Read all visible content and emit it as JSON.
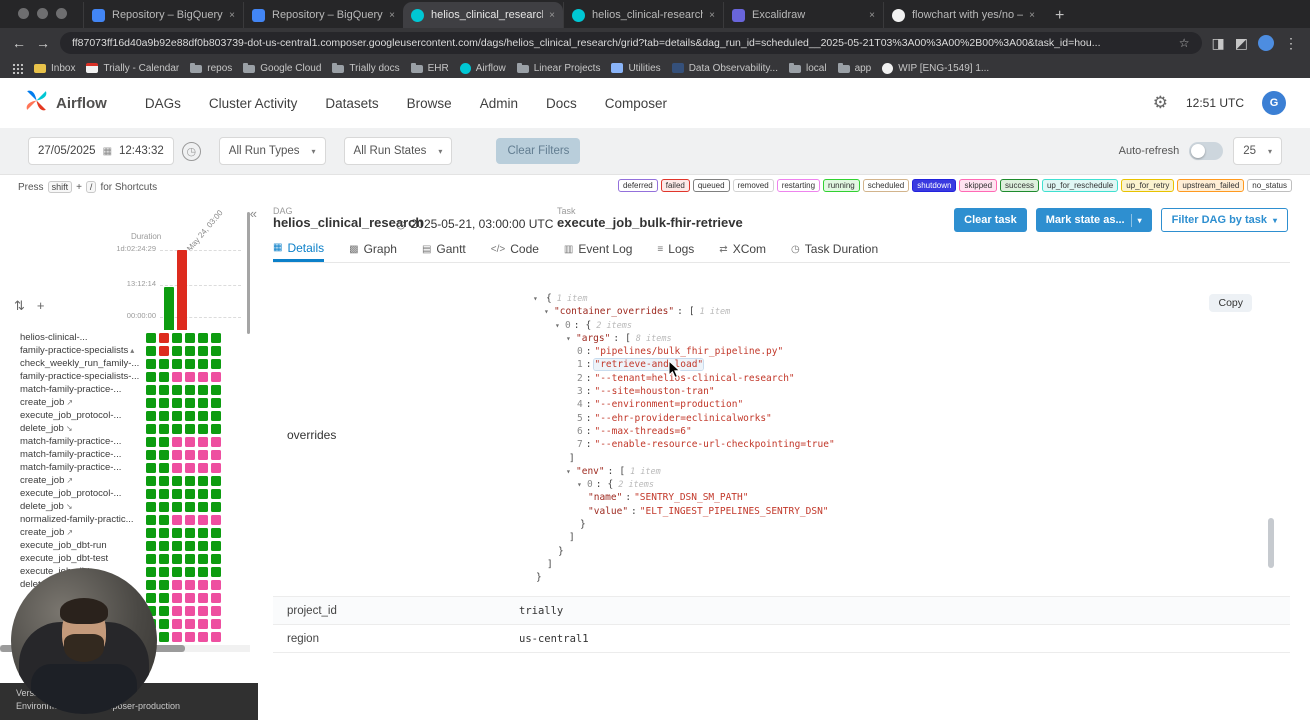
{
  "browser": {
    "tabs": [
      {
        "title": "Repository – BigQuery – trial...",
        "favicon": "bigquery",
        "active": false
      },
      {
        "title": "Repository – BigQuery – trial...",
        "favicon": "bigquery",
        "active": false
      },
      {
        "title": "helios_clinical_research – G...",
        "favicon": "airflow",
        "active": true
      },
      {
        "title": "helios_clinical-research – G...",
        "favicon": "airflow",
        "active": false
      },
      {
        "title": "Excalidraw",
        "favicon": "excalidraw",
        "active": false
      },
      {
        "title": "flowchart with yes/no – Goog...",
        "favicon": "google",
        "active": false
      }
    ],
    "url": "ff87073ff16d40a9b92e88df0b803739-dot-us-central1.composer.googleusercontent.com/dags/helios_clinical_research/grid?tab=details&dag_run_id=scheduled__2025-05-21T03%3A00%3A00%2B00%3A00&task_id=hou...",
    "bookmarks": [
      {
        "label": "Inbox",
        "icon": "mail"
      },
      {
        "label": "Trially - Calendar",
        "icon": "calendar"
      },
      {
        "label": "repos",
        "icon": "folder"
      },
      {
        "label": "Google Cloud",
        "icon": "folder"
      },
      {
        "label": "Trially docs",
        "icon": "folder"
      },
      {
        "label": "EHR",
        "icon": "folder"
      },
      {
        "label": "Airflow",
        "icon": "airflow"
      },
      {
        "label": "Linear Projects",
        "icon": "folder"
      },
      {
        "label": "Utilities",
        "icon": "utilities"
      },
      {
        "label": "Data Observability...",
        "icon": "data"
      },
      {
        "label": "local",
        "icon": "folder"
      },
      {
        "label": "app",
        "icon": "folder"
      },
      {
        "label": "WIP [ENG-1549] 1...",
        "icon": "github"
      }
    ]
  },
  "nav": {
    "brand": "Airflow",
    "items": [
      "DAGs",
      "Cluster Activity",
      "Datasets",
      "Browse",
      "Admin",
      "Docs",
      "Composer"
    ],
    "clock": "12:51 UTC",
    "avatar_letter": "G"
  },
  "filters": {
    "date": "27/05/2025",
    "time": "12:43:32",
    "run_types": "All Run Types",
    "run_states": "All Run States",
    "clear_label": "Clear Filters",
    "auto_refresh_label": "Auto-refresh",
    "page_size": "25"
  },
  "hint": {
    "press": "Press",
    "shift_key": "shift",
    "plus": "+",
    "slash_key": "/",
    "suffix": "for Shortcuts"
  },
  "legend": [
    {
      "label": "deferred",
      "color": "#9370db",
      "bg": "#ffffff"
    },
    {
      "label": "failed",
      "color": "#e0352b",
      "bg": "#fdeae8"
    },
    {
      "label": "queued",
      "color": "#808080",
      "bg": "#ffffff"
    },
    {
      "label": "removed",
      "color": "#d3d3d3",
      "bg": "#ffffff"
    },
    {
      "label": "restarting",
      "color": "#ee82ee",
      "bg": "#ffffff"
    },
    {
      "label": "running",
      "color": "#31d131",
      "bg": "#e2f8e2"
    },
    {
      "label": "scheduled",
      "color": "#d2b48c",
      "bg": "#ffffff"
    },
    {
      "label": "shutdown",
      "color": "#2222dd",
      "bg": "#3a3ae0",
      "text": "#ffffff"
    },
    {
      "label": "skipped",
      "color": "#ff69b4",
      "bg": "#ffe3f1"
    },
    {
      "label": "success",
      "color": "#1e8b2d",
      "bg": "#ddf0dd"
    },
    {
      "label": "up_for_reschedule",
      "color": "#40e0d0",
      "bg": "#e0f7f5"
    },
    {
      "label": "up_for_retry",
      "color": "#e8c200",
      "bg": "#fbf3cf"
    },
    {
      "label": "upstream_failed",
      "color": "#ff9a1f",
      "bg": "#ffeed6"
    },
    {
      "label": "no_status",
      "color": "#bfbfbf",
      "bg": "#ffffff"
    }
  ],
  "run_header": {
    "dag_label": "DAG",
    "dag_name": "helios_clinical_research",
    "run_time": "2025-05-21, 03:00:00 UTC",
    "task_label": "Task",
    "task_name": "execute_job_bulk-fhir-retrieve",
    "clear_task": "Clear task",
    "mark_state": "Mark state as...",
    "filter_dag": "Filter DAG by task"
  },
  "detail_tabs": [
    {
      "label": "Details",
      "icon": "details",
      "active": true
    },
    {
      "label": "Graph",
      "icon": "graph",
      "active": false
    },
    {
      "label": "Gantt",
      "icon": "gantt",
      "active": false
    },
    {
      "label": "Code",
      "icon": "code",
      "active": false
    },
    {
      "label": "Event Log",
      "icon": "event",
      "active": false
    },
    {
      "label": "Logs",
      "icon": "logs",
      "active": false
    },
    {
      "label": "XCom",
      "icon": "xcom",
      "active": false
    },
    {
      "label": "Task Duration",
      "icon": "duration",
      "active": false
    }
  ],
  "grid": {
    "duration_label": "Duration",
    "axis_ticks": [
      "1d:02:24:29",
      "13:12:14",
      "00:00:00"
    ],
    "run_date_label": "May 24, 03:00",
    "bars": [
      {
        "col": 0,
        "height": 43,
        "color": "green"
      },
      {
        "col": 1,
        "height": 80,
        "color": "red"
      }
    ],
    "rows": [
      {
        "label": "helios-clinical-...",
        "suffix": "",
        "cells": [
          "g",
          "r",
          "g",
          "g",
          "g",
          "g"
        ]
      },
      {
        "label": "family-practice-specialists",
        "suffix": "▴",
        "cells": [
          "g",
          "r",
          "g",
          "g",
          "g",
          "g"
        ]
      },
      {
        "label": "check_weekly_run_family-...",
        "suffix": "",
        "cells": [
          "g",
          "g",
          "g",
          "g",
          "g",
          "g"
        ]
      },
      {
        "label": "family-practice-specialists-...",
        "suffix": "",
        "cells": [
          "g",
          "g",
          "p",
          "p",
          "p",
          "p"
        ]
      },
      {
        "label": "match-family-practice-...",
        "suffix": "",
        "cells": [
          "g",
          "g",
          "g",
          "g",
          "g",
          "g"
        ]
      },
      {
        "label": "create_job",
        "suffix": "↗",
        "cells": [
          "g",
          "g",
          "g",
          "g",
          "g",
          "g"
        ]
      },
      {
        "label": "execute_job_protocol-...",
        "suffix": "",
        "cells": [
          "g",
          "g",
          "g",
          "g",
          "g",
          "g"
        ]
      },
      {
        "label": "delete_job",
        "suffix": "↘",
        "cells": [
          "g",
          "g",
          "g",
          "g",
          "g",
          "g"
        ]
      },
      {
        "label": "match-family-practice-...",
        "suffix": "",
        "cells": [
          "g",
          "g",
          "p",
          "p",
          "p",
          "p"
        ]
      },
      {
        "label": "match-family-practice-...",
        "suffix": "",
        "cells": [
          "g",
          "g",
          "p",
          "p",
          "p",
          "p"
        ]
      },
      {
        "label": "match-family-practice-...",
        "suffix": "",
        "cells": [
          "g",
          "g",
          "p",
          "p",
          "p",
          "p"
        ]
      },
      {
        "label": "create_job",
        "suffix": "↗",
        "cells": [
          "g",
          "g",
          "g",
          "g",
          "g",
          "g"
        ]
      },
      {
        "label": "execute_job_protocol-...",
        "suffix": "",
        "cells": [
          "g",
          "g",
          "g",
          "g",
          "g",
          "g"
        ]
      },
      {
        "label": "delete_job",
        "suffix": "↘",
        "cells": [
          "g",
          "g",
          "g",
          "g",
          "g",
          "g"
        ]
      },
      {
        "label": "normalized-family-practic...",
        "suffix": "",
        "cells": [
          "g",
          "g",
          "p",
          "p",
          "p",
          "p"
        ]
      },
      {
        "label": "create_job",
        "suffix": "↗",
        "cells": [
          "g",
          "g",
          "g",
          "g",
          "g",
          "g"
        ]
      },
      {
        "label": "execute_job_dbt-run",
        "suffix": "",
        "cells": [
          "g",
          "g",
          "g",
          "g",
          "g",
          "g"
        ]
      },
      {
        "label": "execute_job_dbt-test",
        "suffix": "",
        "cells": [
          "g",
          "g",
          "g",
          "g",
          "g",
          "g"
        ]
      },
      {
        "label": "execute_job_dbt-...",
        "suffix": "",
        "cells": [
          "g",
          "g",
          "g",
          "g",
          "g",
          "g"
        ]
      },
      {
        "label": "delete_job",
        "suffix": "",
        "cells": [
          "g",
          "g",
          "p",
          "p",
          "p",
          "p"
        ]
      },
      {
        "label": "",
        "suffix": "",
        "cells": [
          "g",
          "g",
          "p",
          "p",
          "p",
          "p"
        ]
      },
      {
        "label": "",
        "suffix": "",
        "cells": [
          "g",
          "g",
          "p",
          "p",
          "p",
          "p"
        ]
      },
      {
        "label": "",
        "suffix": "",
        "cells": [
          "g",
          "g",
          "p",
          "p",
          "p",
          "p"
        ]
      },
      {
        "label": "",
        "suffix": "",
        "cells": [
          "g",
          "g",
          "p",
          "p",
          "p",
          "p"
        ]
      }
    ]
  },
  "overrides_json": {
    "lines": [
      {
        "i": 0,
        "t": [
          [
            "c",
            "▾"
          ],
          [
            "p",
            "{"
          ],
          [
            "m",
            "1 item"
          ]
        ]
      },
      {
        "i": 1,
        "t": [
          [
            "c",
            "▾"
          ],
          [
            "k",
            "\"container_overrides\""
          ],
          [
            "p",
            ":"
          ],
          [
            "p",
            "["
          ],
          [
            "m",
            "1 item"
          ]
        ]
      },
      {
        "i": 2,
        "t": [
          [
            "c",
            "▾"
          ],
          [
            "i",
            "0"
          ],
          [
            "p",
            ":"
          ],
          [
            "p",
            "{"
          ],
          [
            "m",
            "2 items"
          ]
        ]
      },
      {
        "i": 3,
        "t": [
          [
            "c",
            "▾"
          ],
          [
            "k",
            "\"args\""
          ],
          [
            "p",
            ":"
          ],
          [
            "p",
            "["
          ],
          [
            "m",
            "8 items"
          ]
        ]
      },
      {
        "i": 4,
        "t": [
          [
            "i",
            "0"
          ],
          [
            "p",
            ":"
          ],
          [
            "s",
            "\"pipelines/bulk_fhir_pipeline.py\""
          ]
        ]
      },
      {
        "i": 4,
        "t": [
          [
            "i",
            "1"
          ],
          [
            "p",
            ":"
          ],
          [
            "sh",
            "\"retrieve-and-load\""
          ]
        ]
      },
      {
        "i": 4,
        "t": [
          [
            "i",
            "2"
          ],
          [
            "p",
            ":"
          ],
          [
            "s",
            "\"--tenant=helios-clinical-research\""
          ]
        ]
      },
      {
        "i": 4,
        "t": [
          [
            "i",
            "3"
          ],
          [
            "p",
            ":"
          ],
          [
            "s",
            "\"--site=houston-tran\""
          ]
        ]
      },
      {
        "i": 4,
        "t": [
          [
            "i",
            "4"
          ],
          [
            "p",
            ":"
          ],
          [
            "s",
            "\"--environment=production\""
          ]
        ]
      },
      {
        "i": 4,
        "t": [
          [
            "i",
            "5"
          ],
          [
            "p",
            ":"
          ],
          [
            "s",
            "\"--ehr-provider=eclinicalworks\""
          ]
        ]
      },
      {
        "i": 4,
        "t": [
          [
            "i",
            "6"
          ],
          [
            "p",
            ":"
          ],
          [
            "s",
            "\"--max-threads=6\""
          ]
        ]
      },
      {
        "i": 4,
        "t": [
          [
            "i",
            "7"
          ],
          [
            "p",
            ":"
          ],
          [
            "s",
            "\"--enable-resource-url-checkpointing=true\""
          ]
        ]
      },
      {
        "i": 3,
        "t": [
          [
            "p",
            "]"
          ]
        ]
      },
      {
        "i": 3,
        "t": [
          [
            "c",
            "▾"
          ],
          [
            "k",
            "\"env\""
          ],
          [
            "p",
            ":"
          ],
          [
            "p",
            "["
          ],
          [
            "m",
            "1 item"
          ]
        ]
      },
      {
        "i": 4,
        "t": [
          [
            "c",
            "▾"
          ],
          [
            "i",
            "0"
          ],
          [
            "p",
            ":"
          ],
          [
            "p",
            "{"
          ],
          [
            "m",
            "2 items"
          ]
        ]
      },
      {
        "i": 5,
        "t": [
          [
            "k",
            "\"name\""
          ],
          [
            "p",
            ":"
          ],
          [
            "s",
            "\"SENTRY_DSN_SM_PATH\""
          ]
        ]
      },
      {
        "i": 5,
        "t": [
          [
            "k",
            "\"value\""
          ],
          [
            "p",
            ":"
          ],
          [
            "s",
            "\"ELT_INGEST_PIPELINES_SENTRY_DSN\""
          ]
        ]
      },
      {
        "i": 4,
        "t": [
          [
            "p",
            "}"
          ]
        ]
      },
      {
        "i": 3,
        "t": [
          [
            "p",
            "]"
          ]
        ]
      },
      {
        "i": 2,
        "t": [
          [
            "p",
            "}"
          ]
        ]
      },
      {
        "i": 1,
        "t": [
          [
            "p",
            "]"
          ]
        ]
      },
      {
        "i": 0,
        "t": [
          [
            "p",
            "}"
          ]
        ]
      }
    ]
  },
  "attributes": {
    "overrides_label": "overrides",
    "copy_label": "Copy",
    "rows": [
      {
        "key": "project_id",
        "value": "trially"
      },
      {
        "key": "region",
        "value": "us-central1"
      }
    ]
  },
  "footer": {
    "line1": "Version:",
    "line2": "Environment:  trially-composer-production"
  }
}
